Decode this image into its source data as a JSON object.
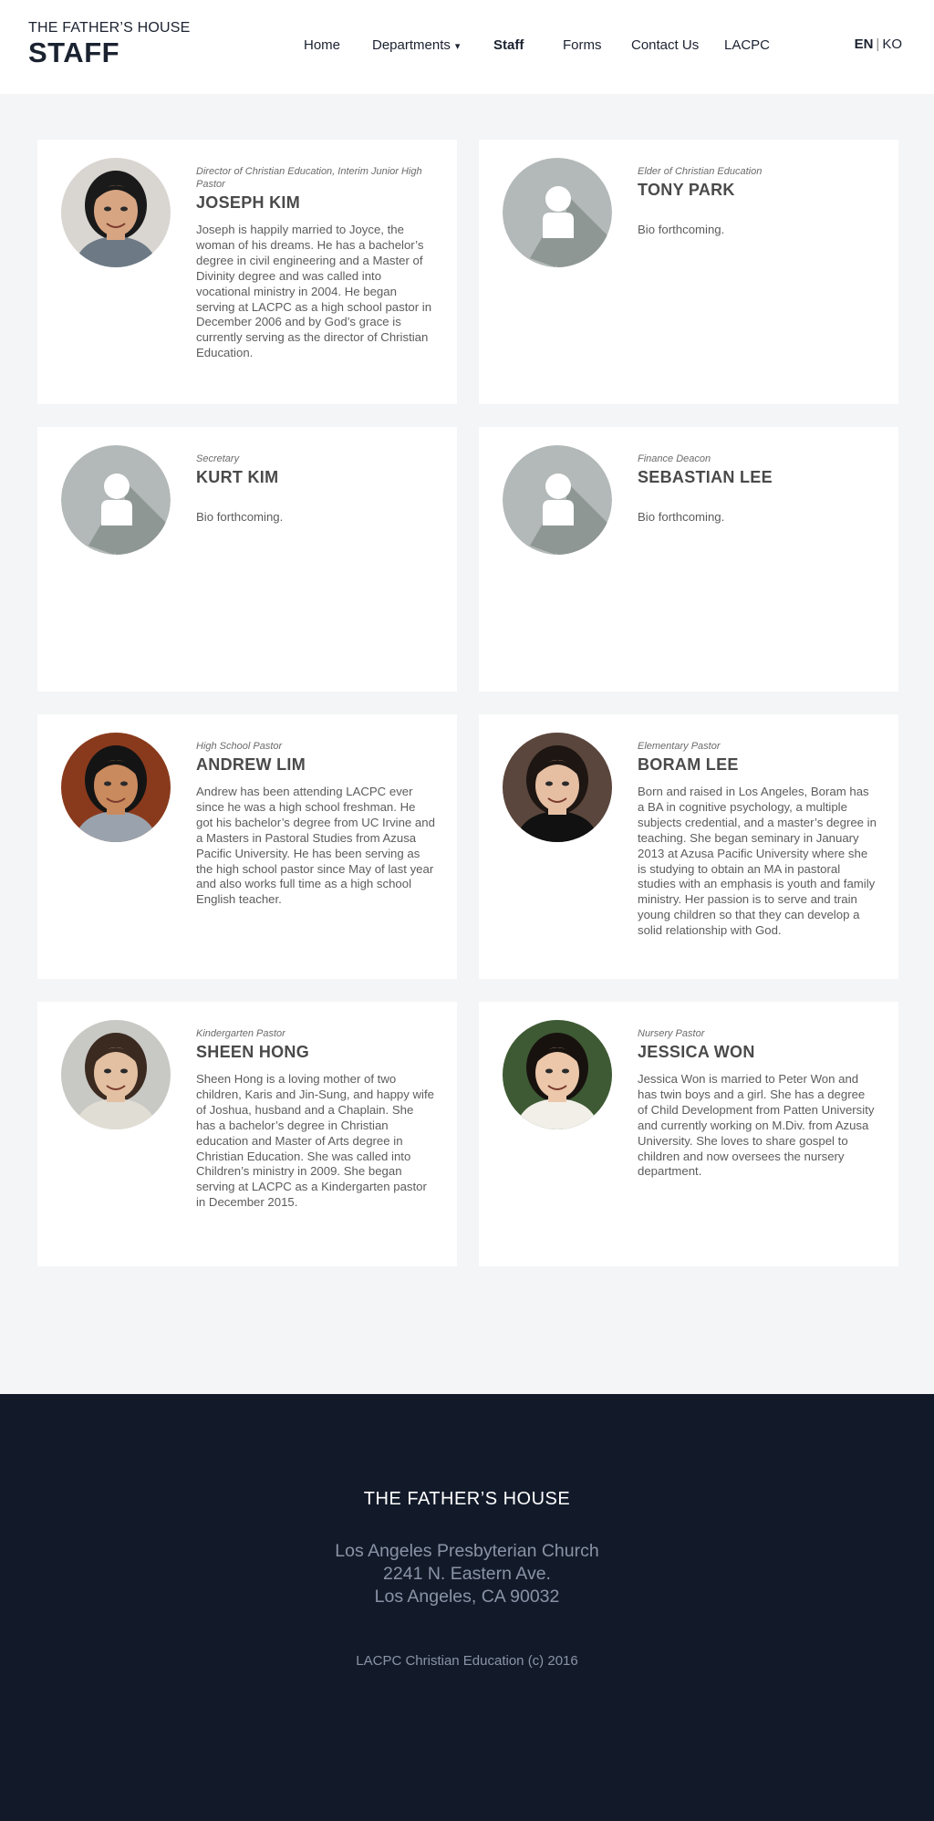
{
  "brand": {
    "house": "THE FATHER’S HOUSE",
    "staff": "STAFF"
  },
  "nav": [
    {
      "label": "Home"
    },
    {
      "label": "Departments",
      "caret": "▾"
    },
    {
      "label": "Staff"
    },
    {
      "label": "Forms"
    },
    {
      "label": "Contact Us"
    },
    {
      "label": "LACPC"
    }
  ],
  "lang": {
    "en": "EN",
    "sep": "|",
    "ko": "KO"
  },
  "staff": [
    {
      "role": "Director of Christian Education,  Interim Junior High Pastor",
      "name": "JOSEPH KIM",
      "bio": "Joseph is happily married to Joyce, the woman of his dreams. He has a bachelor’s degree in civil engineering and a Master of Divinity degree and was called into vocational ministry in 2004. He began serving at LACPC as a high school pastor in December 2006 and by God’s grace is currently serving as the director of Christian Education.",
      "avatar": "photo"
    },
    {
      "role": "Elder of Christian Education",
      "name": "TONY PARK",
      "bio": "Bio forthcoming.",
      "avatar": "placeholder"
    },
    {
      "role": "Secretary",
      "name": "KURT KIM",
      "bio": "Bio forthcoming.",
      "avatar": "placeholder"
    },
    {
      "role": "Finance Deacon",
      "name": "SEBASTIAN LEE",
      "bio": "Bio forthcoming.",
      "avatar": "placeholder"
    },
    {
      "role": "High School Pastor",
      "name": "ANDREW LIM",
      "bio": "Andrew has been attending LACPC ever since he was a high school freshman. He got his bachelor’s degree from UC Irvine and a Masters in Pastoral Studies from Azusa Pacific University. He has been serving as the high school pastor since May of last year and also works full time as a high school English teacher.",
      "avatar": "photo"
    },
    {
      "role": "Elementary Pastor",
      "name": "BORAM LEE",
      "bio": "Born and raised in Los Angeles, Boram has a BA in cognitive psychology, a multiple subjects credential, and a master’s degree in teaching. She began seminary in January 2013 at Azusa Pacific University where she is studying to obtain an MA in pastoral studies with an emphasis is youth and family ministry. Her passion is to serve and train young children so that they can develop a solid relationship with God.",
      "avatar": "photo"
    },
    {
      "role": "Kindergarten Pastor",
      "name": "SHEEN HONG",
      "bio": "Sheen Hong is a loving mother of two children, Karis and Jin-Sung, and happy wife of Joshua, husband and a Chaplain. She has a bachelor’s degree in Christian education and Master of Arts degree in Christian Education. She was called into Children’s ministry in 2009. She began serving at LACPC as a Kindergarten pastor in December 2015.",
      "avatar": "photo"
    },
    {
      "role": "Nursery Pastor",
      "name": "JESSICA WON",
      "bio": "Jessica Won is married to Peter Won and has twin boys and a girl. She has a degree of Child Development from Patten University and currently working on M.Div. from Azusa University. She loves to share gospel to children and now oversees the nursery department.",
      "avatar": "photo"
    }
  ],
  "footer": {
    "title": "THE FATHER’S HOUSE",
    "address": [
      "Los Angeles Presbyterian Church",
      "2241 N. Eastern Ave.",
      "Los Angeles, CA 90032"
    ],
    "copyright": "LACPC Christian Education (c) 2016"
  },
  "colors": {
    "footer_bg": "#121a2a",
    "placeholder_bg": "#b3b9b8",
    "placeholder_shadow": "#8f9795"
  }
}
